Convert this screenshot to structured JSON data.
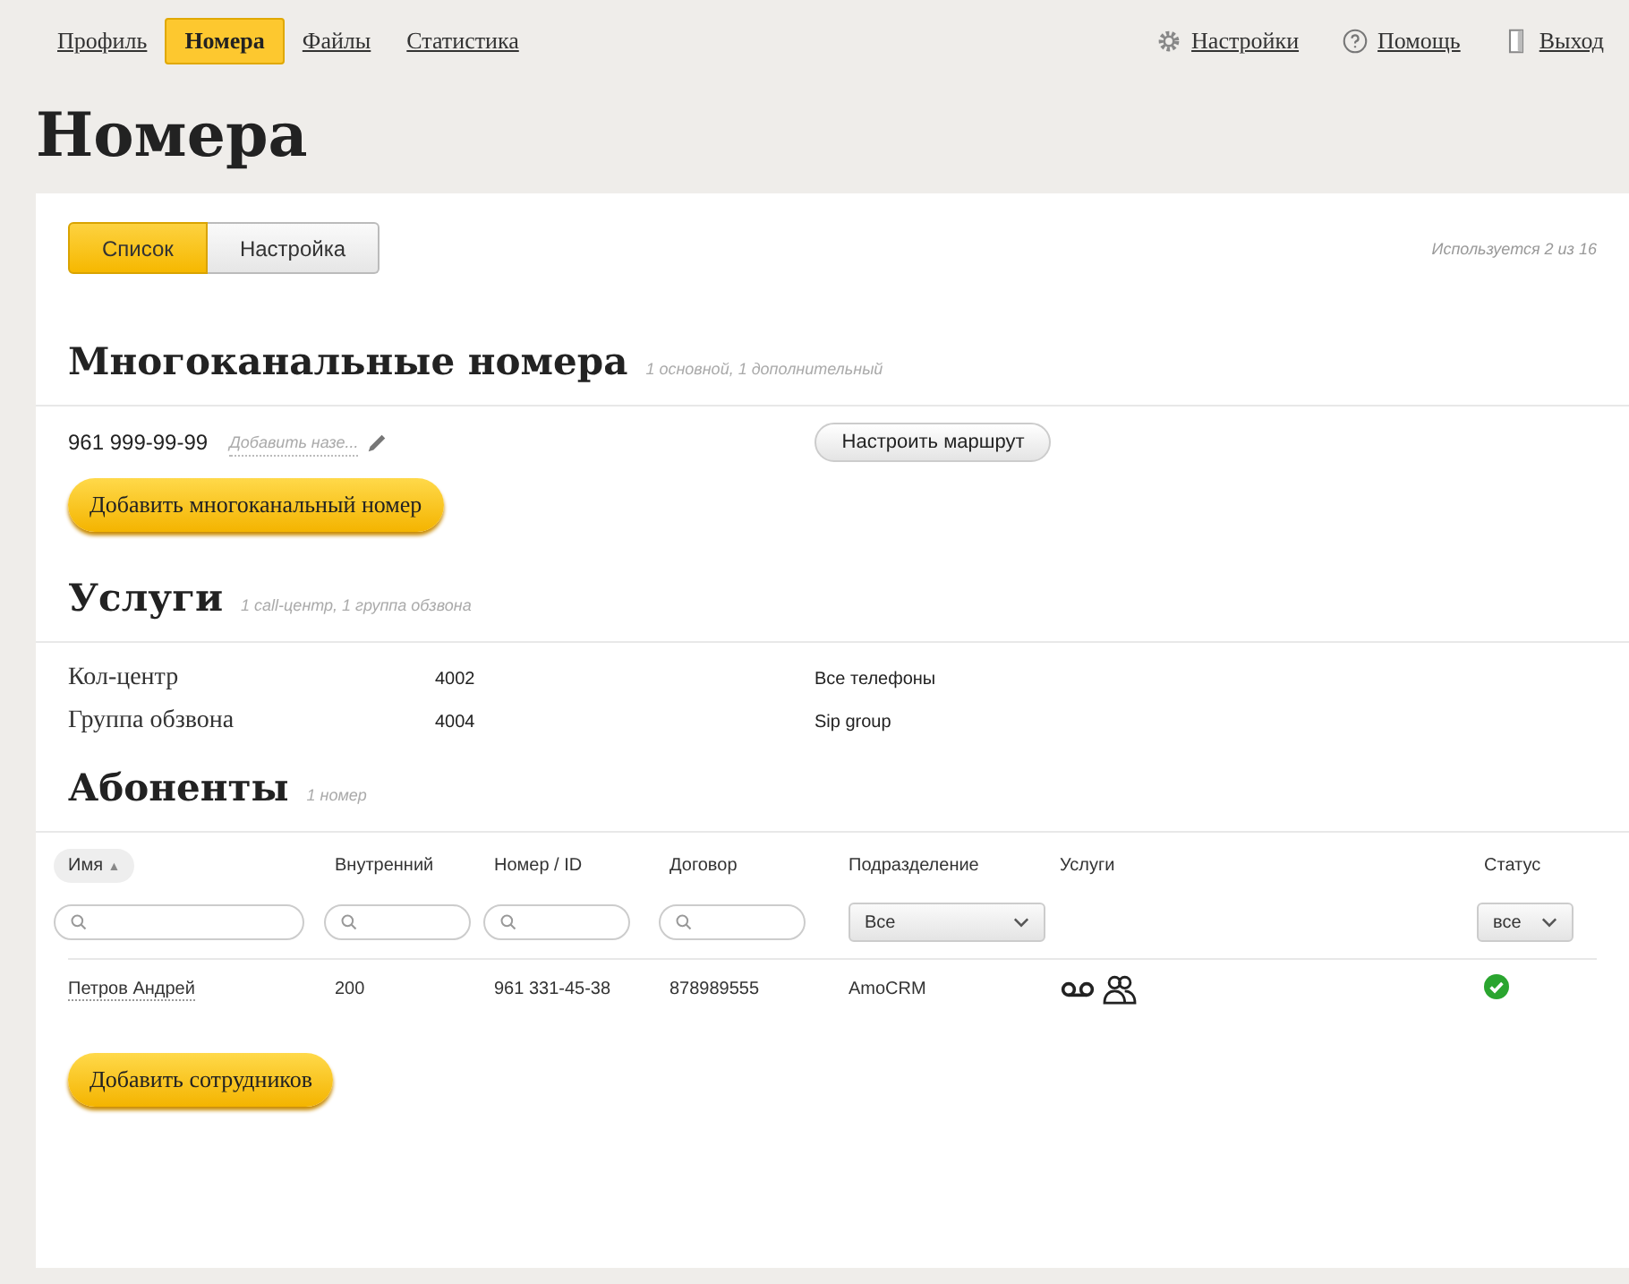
{
  "nav": {
    "left": [
      {
        "label": "Профиль",
        "selected": false
      },
      {
        "label": "Номера",
        "selected": true
      },
      {
        "label": "Файлы",
        "selected": false
      },
      {
        "label": "Статистика",
        "selected": false
      }
    ],
    "right": [
      {
        "kind": "gear",
        "label": "Настройки"
      },
      {
        "kind": "help",
        "label": "Помощь"
      },
      {
        "kind": "exit",
        "label": "Выход"
      }
    ]
  },
  "page_title": "Номера",
  "tabs": [
    {
      "label": "Список",
      "selected": true
    },
    {
      "label": "Настройка",
      "selected": false
    }
  ],
  "usage": "Используется 2 из 16",
  "multichannel": {
    "title": "Многоканальные номера",
    "subtitle": "1 основной, 1 дополнительный",
    "number": "961 999-99-99",
    "name_placeholder": "Добавить назе...",
    "route_button": "Настроить маршрут",
    "add_button": "Добавить многоканальный номер"
  },
  "services": {
    "title": "Услуги",
    "subtitle": "1 call-центр, 1 группа обзвона",
    "rows": [
      {
        "name": "Кол-центр",
        "number": "4002",
        "target": "Все телефоны"
      },
      {
        "name": "Группа обзвона",
        "number": "4004",
        "target": "Sip group"
      }
    ]
  },
  "subscribers": {
    "title": "Абоненты",
    "subtitle": "1 номер",
    "columns": [
      {
        "label": "Имя",
        "sort": "▲",
        "kind": "search"
      },
      {
        "label": "Внутренний",
        "kind": "search"
      },
      {
        "label": "Номер / ID",
        "kind": "search"
      },
      {
        "label": "Договор",
        "kind": "search"
      },
      {
        "label": "Подразделение",
        "kind": "select",
        "value": "Все"
      },
      {
        "label": "Услуги",
        "kind": "none"
      },
      {
        "label": "Статус",
        "kind": "select",
        "value": "все"
      }
    ],
    "rows": [
      {
        "name": "Петров Андрей",
        "internal": "200",
        "number": "961 331-45-38",
        "contract": "878989555",
        "division": "AmoCRM",
        "services": [
          {
            "kind": "voicemail"
          },
          {
            "kind": "group"
          }
        ],
        "online": true
      }
    ],
    "add_button": "Добавить сотрудников"
  }
}
